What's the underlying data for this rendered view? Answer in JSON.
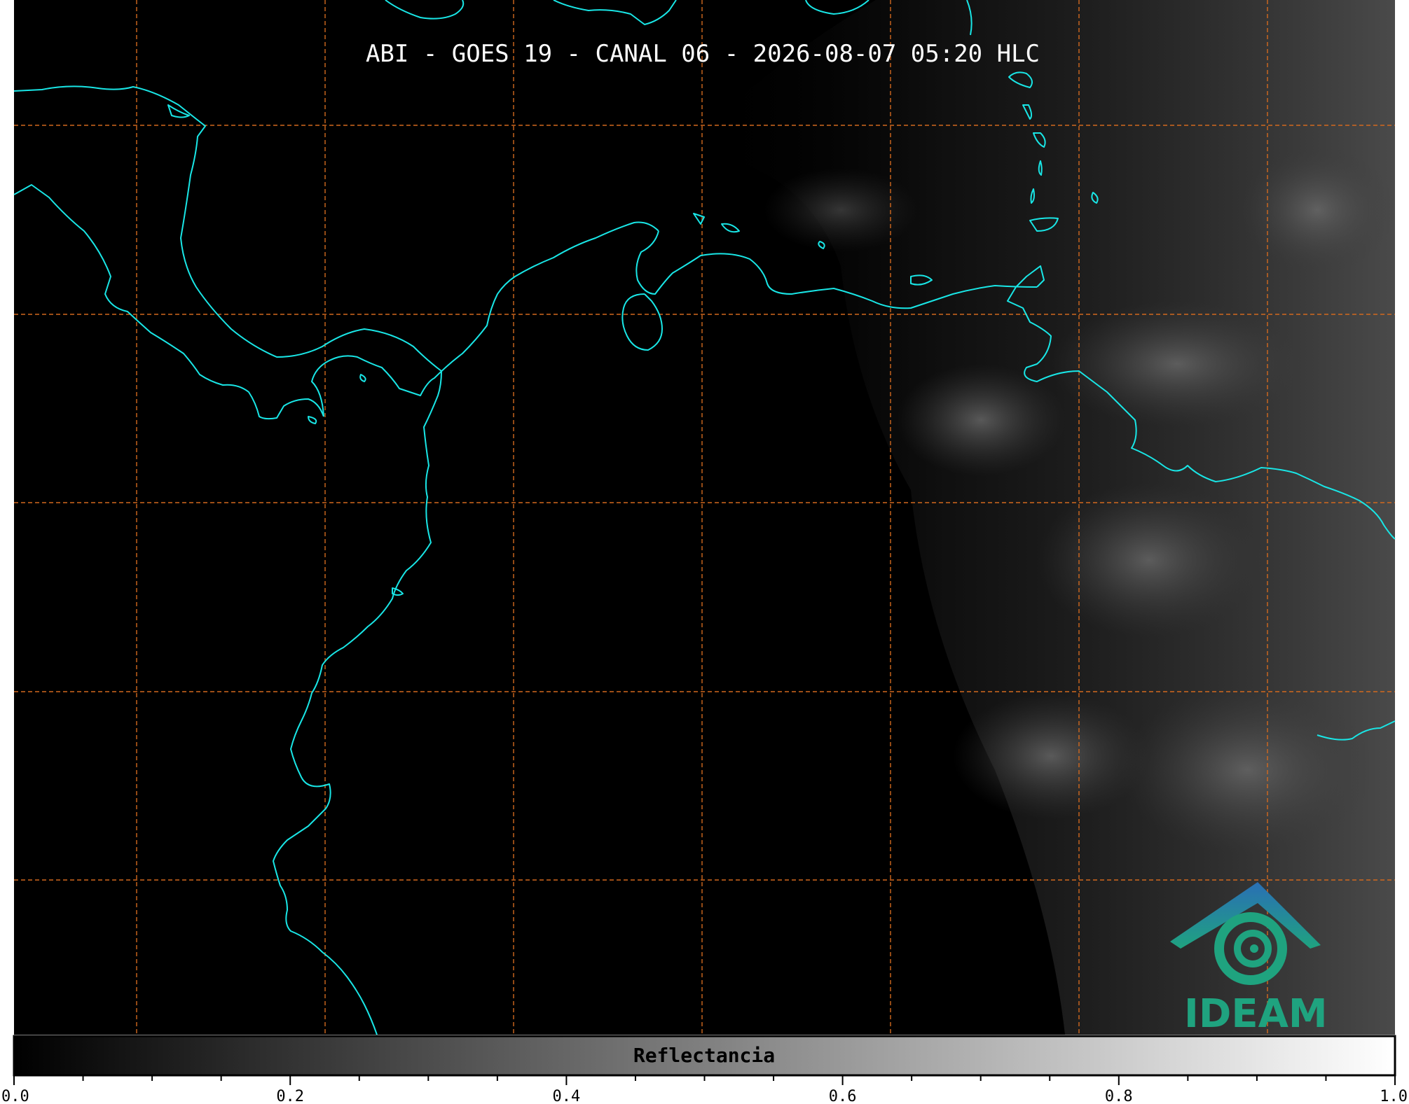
{
  "title": "ABI - GOES 19 - CANAL 06 - 2026-08-07 05:20 HLC",
  "colorbar": {
    "label": "Reflectancia",
    "ticks": [
      "0.0",
      "0.2",
      "0.4",
      "0.6",
      "0.8",
      "1.0"
    ],
    "range": [
      0.0,
      1.0
    ],
    "colormap": "grayscale"
  },
  "logo": {
    "text": "IDEAM"
  },
  "colors": {
    "background": "#000000",
    "coastline": "#19e6e6",
    "gridline": "#d2691e",
    "logo_blue": "#2a6fb5",
    "logo_green": "#1fa37f"
  }
}
